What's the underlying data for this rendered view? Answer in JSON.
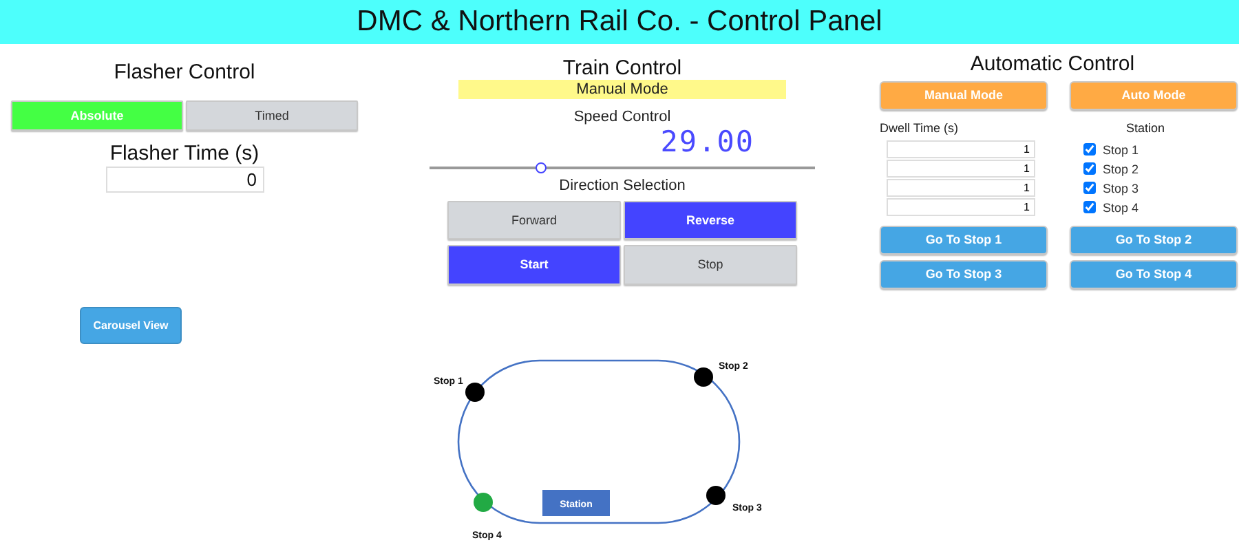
{
  "header": {
    "title": "DMC & Northern Rail Co. - Control Panel"
  },
  "flasher": {
    "title": "Flasher Control",
    "modes": [
      {
        "label": "Absolute",
        "selected": true
      },
      {
        "label": "Timed",
        "selected": false
      }
    ],
    "time_label": "Flasher Time (s)",
    "time_value": "0",
    "carousel_button": "Carousel View"
  },
  "train": {
    "title": "Train Control",
    "mode_banner": "Manual Mode",
    "speed_label": "Speed Control",
    "speed_value": "29.00",
    "speed": {
      "level": 0.29
    },
    "direction_label": "Direction Selection",
    "direction": [
      {
        "label": "Forward",
        "selected": false
      },
      {
        "label": "Reverse",
        "selected": true
      }
    ],
    "run": [
      {
        "label": "Start",
        "selected": true
      },
      {
        "label": "Stop",
        "selected": false
      }
    ]
  },
  "automatic": {
    "title": "Automatic Control",
    "mode_buttons": [
      "Manual Mode",
      "Auto Mode"
    ],
    "dwell_label": "Dwell Time (s)",
    "station_label": "Station",
    "stops": [
      {
        "dwell": "1",
        "label": "Stop 1",
        "checked": true
      },
      {
        "dwell": "1",
        "label": "Stop 2",
        "checked": true
      },
      {
        "dwell": "1",
        "label": "Stop 3",
        "checked": true
      },
      {
        "dwell": "1",
        "label": "Stop 4",
        "checked": true
      }
    ],
    "goto_buttons": [
      "Go To Stop 1",
      "Go To Stop 2",
      "Go To Stop 3",
      "Go To Stop 4"
    ]
  },
  "map": {
    "station_label": "Station",
    "stops": [
      {
        "label": "Stop 1",
        "color": "#000000"
      },
      {
        "label": "Stop 2",
        "color": "#000000"
      },
      {
        "label": "Stop 3",
        "color": "#000000"
      },
      {
        "label": "Stop 4",
        "color": "#22aa44"
      }
    ]
  }
}
